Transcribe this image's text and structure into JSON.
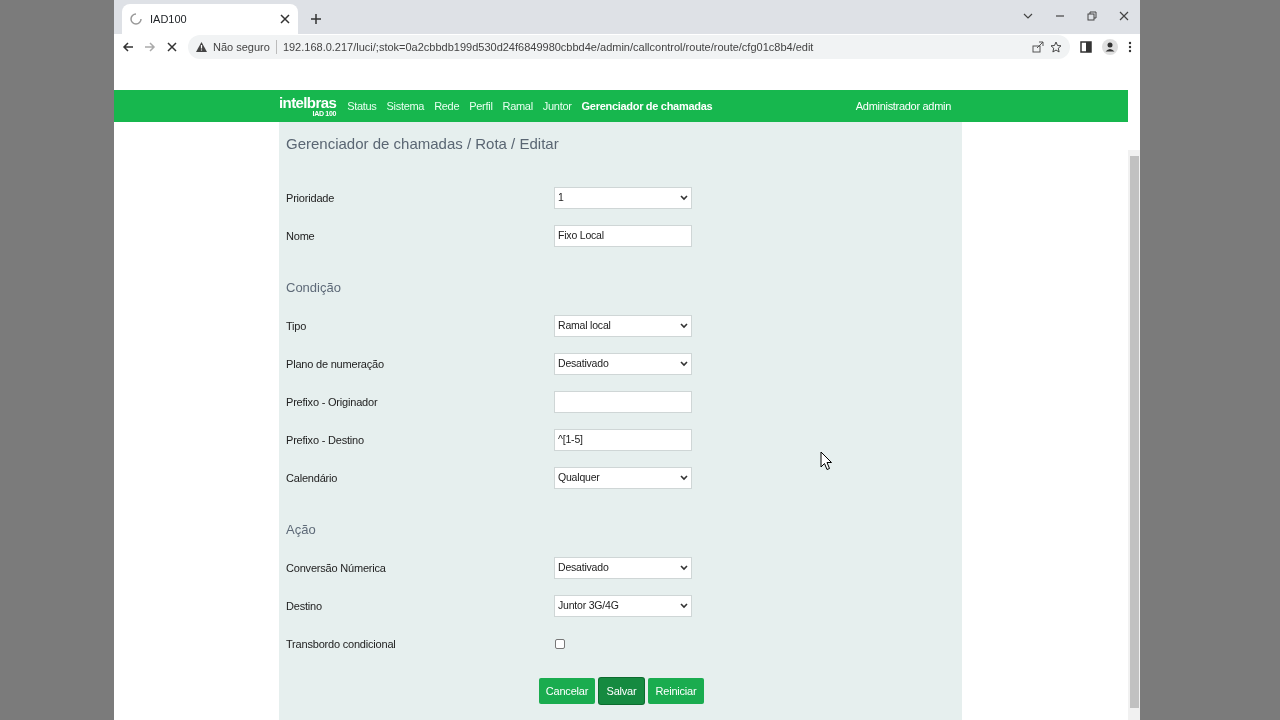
{
  "browser": {
    "tab_title": "IAD100",
    "security_label": "Não seguro",
    "url": "192.168.0.217/luci/;stok=0a2cbbdb199d530d24f6849980cbbd4e/admin/callcontrol/route/route/cfg01c8b4/edit"
  },
  "nav": {
    "logo": "intelbras",
    "logo_sub": "IAD 100",
    "items": [
      {
        "label": "Status",
        "selected": false
      },
      {
        "label": "Sistema",
        "selected": false
      },
      {
        "label": "Rede",
        "selected": false
      },
      {
        "label": "Perfil",
        "selected": false
      },
      {
        "label": "Ramal",
        "selected": false
      },
      {
        "label": "Juntor",
        "selected": false
      },
      {
        "label": "Gerenciador de chamadas",
        "selected": true
      }
    ],
    "user": "Administrador admin"
  },
  "page": {
    "title": "Gerenciador de chamadas / Rota / Editar",
    "sections": [
      {
        "fields": [
          {
            "kind": "select",
            "label": "Prioridade",
            "value": "1"
          },
          {
            "kind": "text",
            "label": "Nome",
            "value": "Fixo Local"
          }
        ]
      },
      {
        "heading": "Condição",
        "fields": [
          {
            "kind": "select",
            "label": "Tipo",
            "value": "Ramal local"
          },
          {
            "kind": "select",
            "label": "Plano de numeração",
            "value": "Desativado"
          },
          {
            "kind": "text",
            "label": "Prefixo - Originador"
          },
          {
            "kind": "text",
            "label": "Prefixo - Destino",
            "value": "^[1-5]"
          },
          {
            "kind": "select",
            "label": "Calendário",
            "value": "Qualquer"
          }
        ]
      },
      {
        "heading": "Ação",
        "fields": [
          {
            "kind": "select",
            "label": "Conversão Númerica",
            "value": "Desativado"
          },
          {
            "kind": "select",
            "label": "Destino",
            "value": "Juntor 3G/4G"
          },
          {
            "kind": "checkbox",
            "label": "Transbordo condicional",
            "checked": false
          }
        ]
      }
    ],
    "buttons": [
      {
        "label": "Cancelar",
        "focused": false
      },
      {
        "label": "Salvar",
        "focused": true
      },
      {
        "label": "Reiniciar",
        "focused": false
      }
    ]
  }
}
